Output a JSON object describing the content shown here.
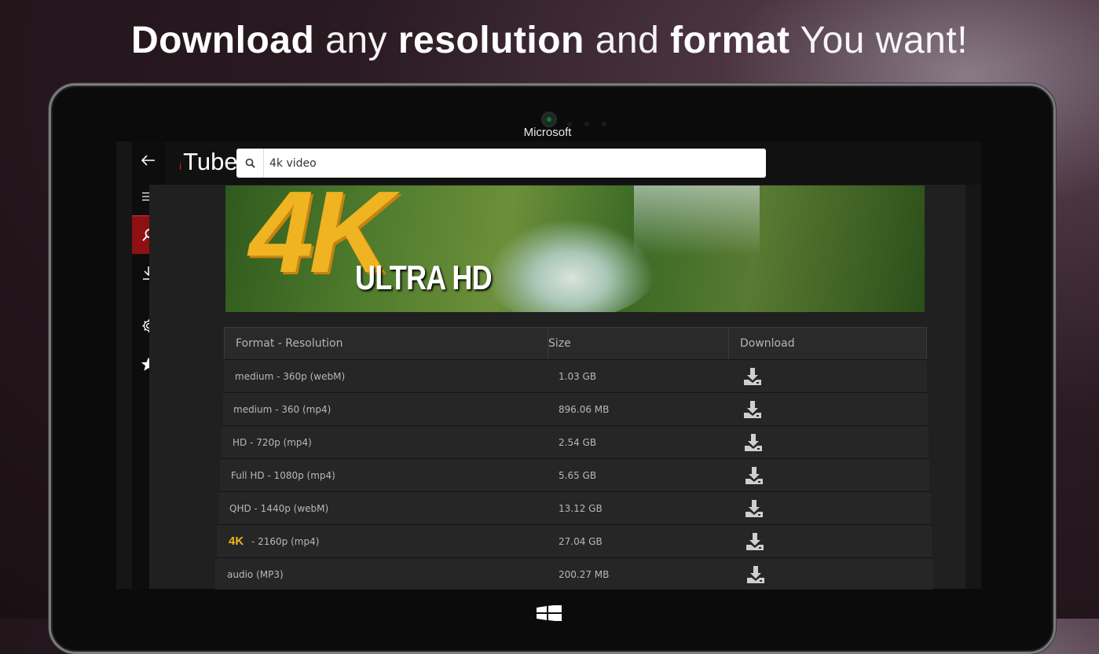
{
  "headline": {
    "w1": "Download",
    "w2": "any",
    "w3": "resolution",
    "w4": "and",
    "w5": "format",
    "w6": "You want!"
  },
  "device": {
    "brand": "Microsoft"
  },
  "app": {
    "logo_prefix": "i",
    "logo_name": "Tube",
    "search": {
      "value": "4k video",
      "icon": "search-icon"
    },
    "sidebar": [
      "back-arrow-icon",
      "hamburger-menu-icon",
      "search-icon",
      "download-icon",
      "gear-icon",
      "star-icon"
    ],
    "accent": "#8f1012"
  },
  "banner": {
    "big": "4K",
    "sub": "ULTRA HD"
  },
  "table": {
    "headers": {
      "format": "Format - Resolution",
      "size": "Size",
      "download": "Download"
    },
    "rows": [
      {
        "format": "medium - 360p (webM)",
        "size": "1.03 GB"
      },
      {
        "format": "medium - 360 (mp4)",
        "size": "896.06 MB"
      },
      {
        "format": "HD - 720p (mp4)",
        "size": "2.54 GB"
      },
      {
        "format": "Full HD - 1080p (mp4)",
        "size": "5.65 GB"
      },
      {
        "format": "QHD - 1440p (webM)",
        "size": "13.12 GB"
      },
      {
        "badge": "4K",
        "format": " - 2160p (mp4)",
        "size": "27.04 GB"
      },
      {
        "format": "audio (MP3)",
        "size": "200.27 MB"
      }
    ]
  }
}
